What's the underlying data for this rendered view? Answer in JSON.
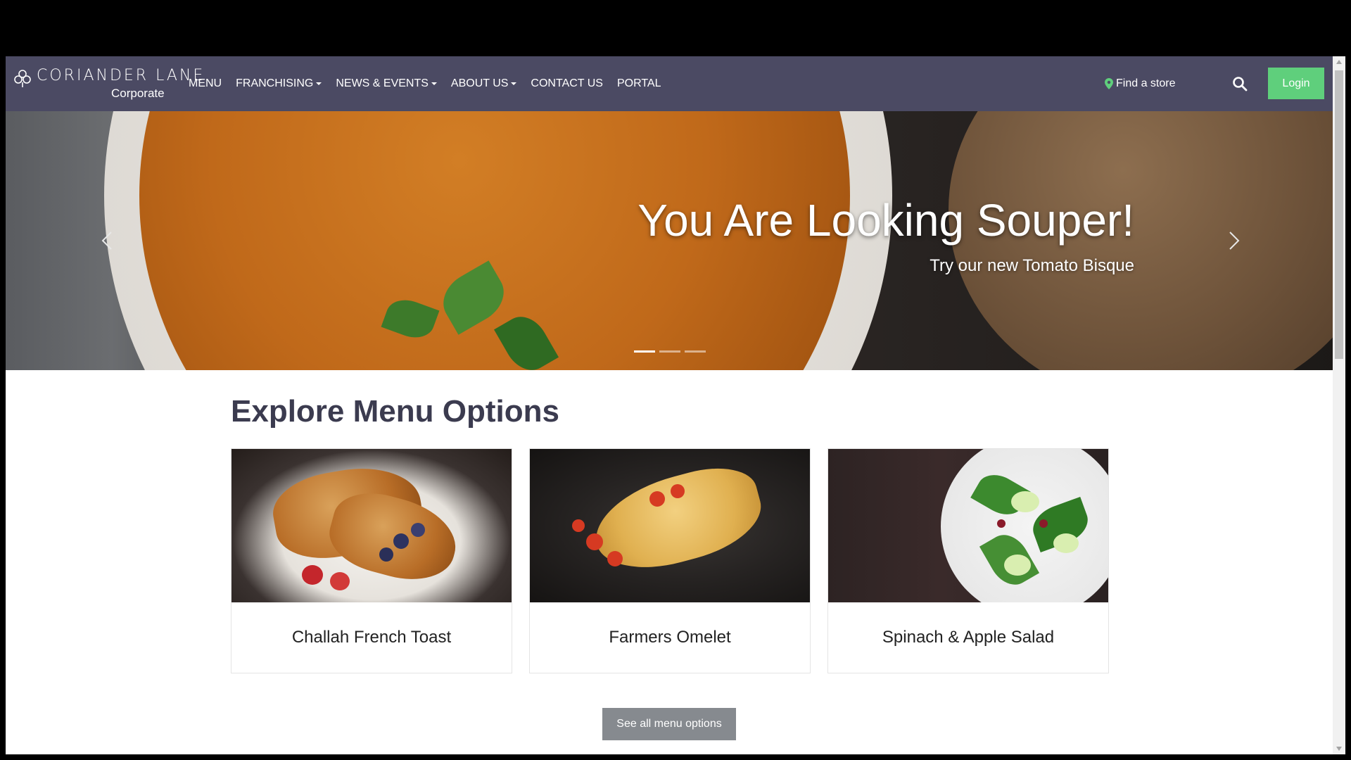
{
  "brand": {
    "name": "CORIANDER LANE",
    "subtitle": "Corporate"
  },
  "nav": {
    "items": [
      {
        "label": "MENU",
        "dropdown": false
      },
      {
        "label": "FRANCHISING",
        "dropdown": true
      },
      {
        "label": "NEWS & EVENTS",
        "dropdown": true
      },
      {
        "label": "ABOUT US",
        "dropdown": true
      },
      {
        "label": "CONTACT US",
        "dropdown": false
      },
      {
        "label": "PORTAL",
        "dropdown": false
      }
    ],
    "find_store": "Find a store",
    "search_icon": "search-icon",
    "login_label": "Login"
  },
  "hero": {
    "title": "You Are Looking Souper!",
    "subtitle": "Try our new Tomato Bisque",
    "slide_count": 3,
    "active_slide": 1
  },
  "menu_section": {
    "title": "Explore Menu Options",
    "cards": [
      {
        "label": "Challah French Toast"
      },
      {
        "label": "Farmers Omelet"
      },
      {
        "label": "Spinach & Apple Salad"
      }
    ],
    "see_all_label": "See all menu options"
  },
  "colors": {
    "navbar_bg": "#4b4a63",
    "login_bg": "#5fcf7c",
    "see_all_bg": "#868a8f",
    "title_text": "#3b3b4f"
  }
}
